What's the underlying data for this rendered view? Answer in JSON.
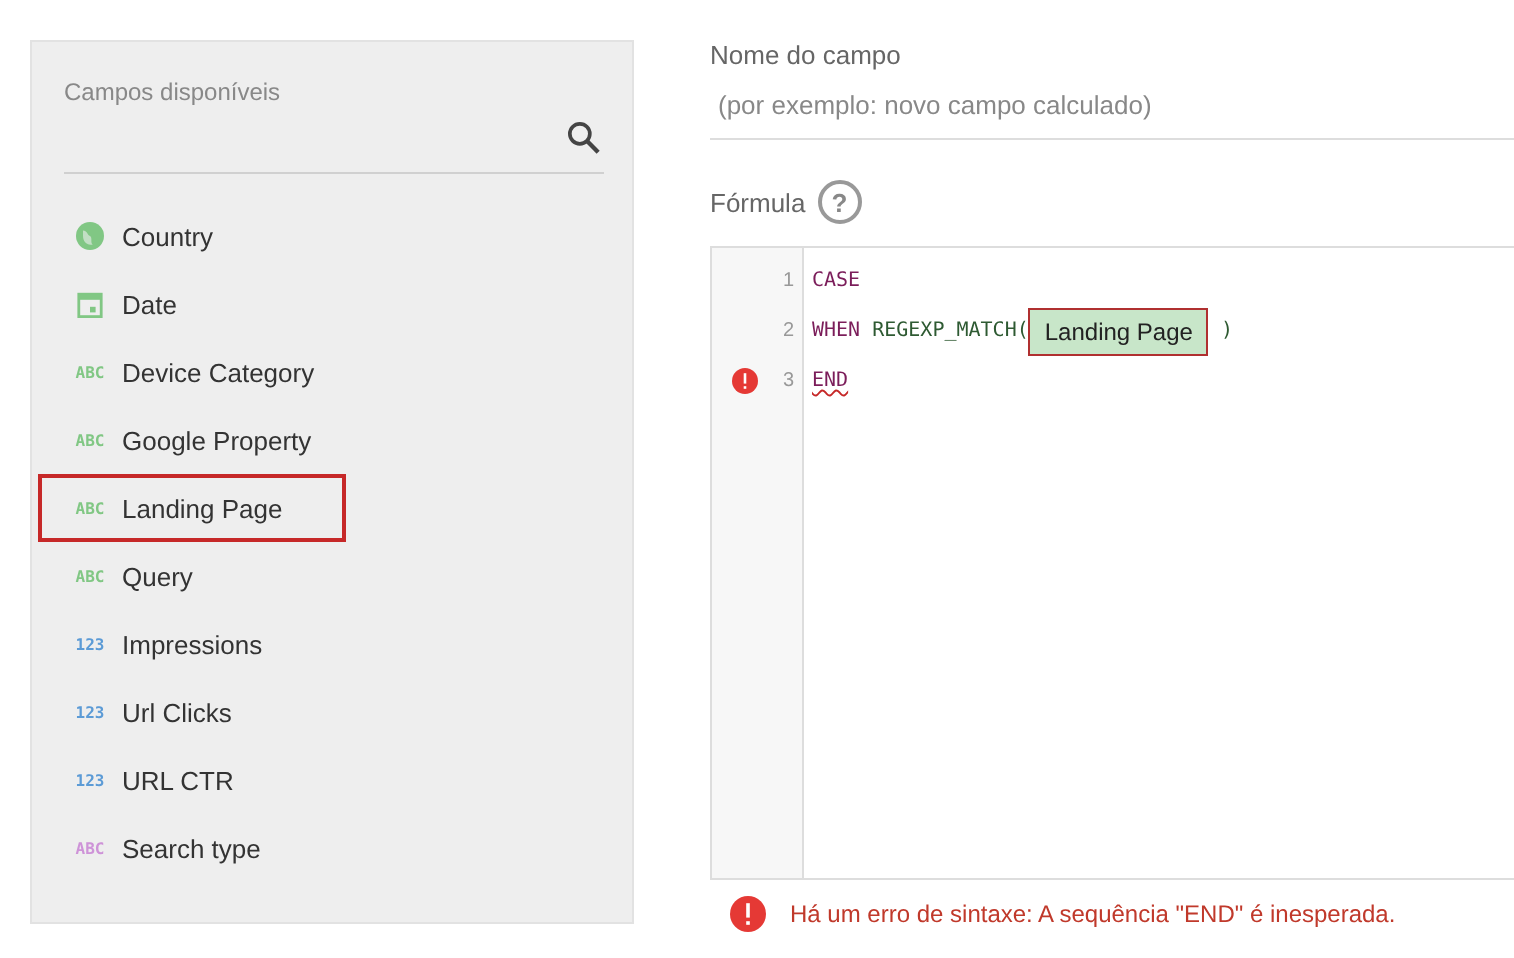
{
  "fields_panel": {
    "title": "Campos disponíveis",
    "items": [
      {
        "kind": "geo",
        "label": "Country",
        "highlighted": false,
        "color": "#81c784"
      },
      {
        "kind": "date",
        "label": "Date",
        "highlighted": false,
        "color": "#81c784"
      },
      {
        "kind": "text",
        "type_label": "ABC",
        "label": "Device Category",
        "highlighted": false,
        "color": "#81c784"
      },
      {
        "kind": "text",
        "type_label": "ABC",
        "label": "Google Property",
        "highlighted": false,
        "color": "#81c784"
      },
      {
        "kind": "text",
        "type_label": "ABC",
        "label": "Landing Page",
        "highlighted": true,
        "color": "#81c784"
      },
      {
        "kind": "text",
        "type_label": "ABC",
        "label": "Query",
        "highlighted": false,
        "color": "#81c784"
      },
      {
        "kind": "number",
        "type_label": "123",
        "label": "Impressions",
        "highlighted": false,
        "color": "#5c9bd6"
      },
      {
        "kind": "number",
        "type_label": "123",
        "label": "Url Clicks",
        "highlighted": false,
        "color": "#5c9bd6"
      },
      {
        "kind": "number",
        "type_label": "123",
        "label": "URL CTR",
        "highlighted": false,
        "color": "#5c9bd6"
      },
      {
        "kind": "text",
        "type_label": "ABC",
        "label": "Search type",
        "highlighted": false,
        "color": "#ce93d8"
      }
    ]
  },
  "field_name": {
    "label": "Nome do campo",
    "placeholder": "(por exemplo: novo campo calculado)"
  },
  "formula": {
    "label": "Fórmula",
    "help_icon": "?",
    "lines": [
      {
        "number": "1",
        "error": false,
        "parts": [
          {
            "kind": "keyword",
            "text": "CASE"
          }
        ]
      },
      {
        "number": "2",
        "error": false,
        "parts": [
          {
            "kind": "keyword",
            "text": "WHEN"
          },
          {
            "kind": "function",
            "text": "REGEXP_MATCH("
          },
          {
            "kind": "field",
            "text": "Landing Page"
          },
          {
            "kind": "function",
            "text": ")"
          }
        ]
      },
      {
        "number": "3",
        "error": true,
        "parts": [
          {
            "kind": "error",
            "text": "END"
          }
        ]
      }
    ],
    "error_message": "Há um erro de sintaxe: A sequência \"END\" é inesperada."
  }
}
